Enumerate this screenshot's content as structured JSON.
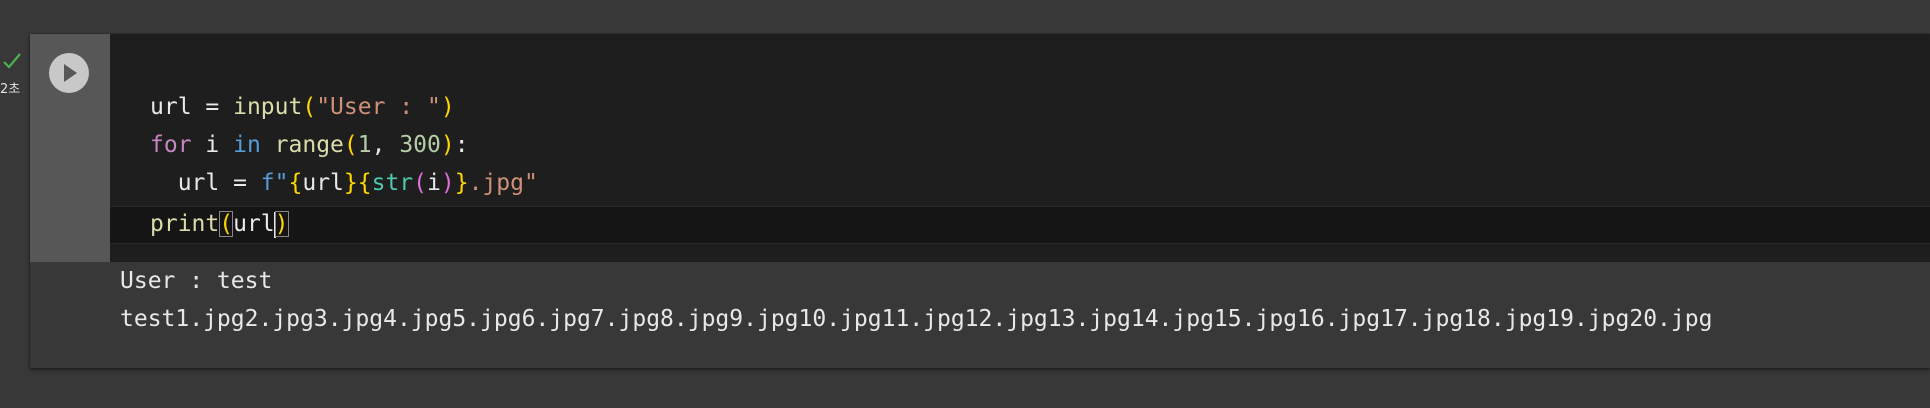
{
  "execution": {
    "status_icon": "check-icon",
    "status_color": "#4caf50",
    "time_label": "2초"
  },
  "cell": {
    "run_icon": "play-icon",
    "code": {
      "line1": {
        "t1": "url",
        "t2": " = ",
        "t3": "input",
        "t4": "(",
        "t5": "\"User : \"",
        "t6": ")"
      },
      "line2": {
        "t1": "for",
        "t2": " i ",
        "t3": "in",
        "t4": " ",
        "t5": "range",
        "t6": "(",
        "t7": "1",
        "t8": ", ",
        "t9": "300",
        "t10": ")",
        "t11": ":"
      },
      "line3": {
        "t1": "  url = ",
        "t2": "f\"",
        "t3": "{",
        "t4": "url",
        "t5": "}",
        "t6": "{",
        "t7": "str",
        "t8": "(",
        "t9": "i",
        "t10": ")",
        "t11": "}",
        "t12": ".jpg\""
      },
      "line5": {
        "t1": "print",
        "t2": "(",
        "t3": "url",
        "t4": ")"
      }
    },
    "output": {
      "line1": "User : test",
      "line2": "test1.jpg2.jpg3.jpg4.jpg5.jpg6.jpg7.jpg8.jpg9.jpg10.jpg11.jpg12.jpg13.jpg14.jpg15.jpg16.jpg17.jpg18.jpg19.jpg20.jpg"
    }
  },
  "colors": {
    "background": "#383838",
    "editor_background": "#1e1e1e",
    "gutter": "#575757"
  }
}
